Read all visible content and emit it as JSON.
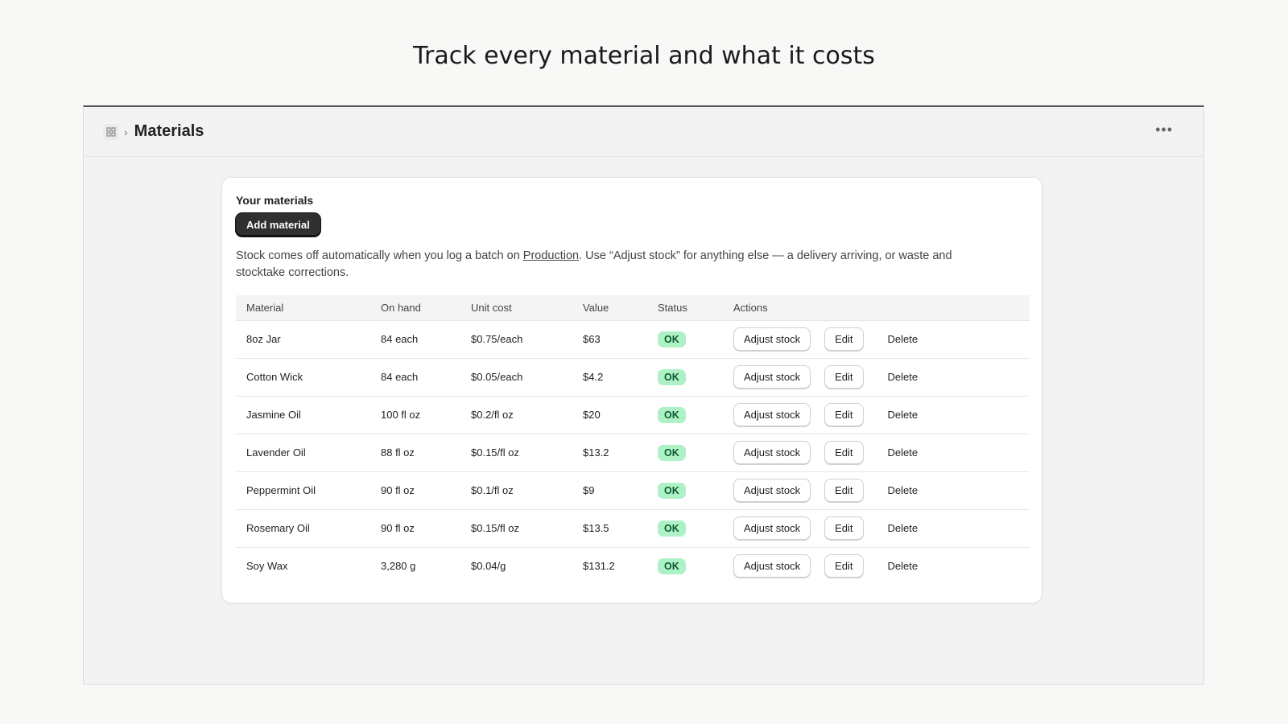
{
  "headline": "Track every material and what it costs",
  "breadcrumb": {
    "title": "Materials",
    "app_icon": "grid-icon",
    "more_icon": "ellipsis-icon"
  },
  "card": {
    "title": "Your materials",
    "add_label": "Add material",
    "desc_before": "Stock comes off automatically when you log a batch on ",
    "desc_link": "Production",
    "desc_after": ". Use “Adjust stock” for anything else — a delivery arriving, or waste and stocktake corrections."
  },
  "table": {
    "headers": [
      "Material",
      "On hand",
      "Unit cost",
      "Value",
      "Status",
      "Actions"
    ],
    "rows": [
      {
        "material": "8oz Jar",
        "on_hand": "84 each",
        "unit_cost": "$0.75/each",
        "value": "$63",
        "status": "OK"
      },
      {
        "material": "Cotton Wick",
        "on_hand": "84 each",
        "unit_cost": "$0.05/each",
        "value": "$4.2",
        "status": "OK"
      },
      {
        "material": "Jasmine Oil",
        "on_hand": "100 fl oz",
        "unit_cost": "$0.2/fl oz",
        "value": "$20",
        "status": "OK"
      },
      {
        "material": "Lavender Oil",
        "on_hand": "88 fl oz",
        "unit_cost": "$0.15/fl oz",
        "value": "$13.2",
        "status": "OK"
      },
      {
        "material": "Peppermint Oil",
        "on_hand": "90 fl oz",
        "unit_cost": "$0.1/fl oz",
        "value": "$9",
        "status": "OK"
      },
      {
        "material": "Rosemary Oil",
        "on_hand": "90 fl oz",
        "unit_cost": "$0.15/fl oz",
        "value": "$13.5",
        "status": "OK"
      },
      {
        "material": "Soy Wax",
        "on_hand": "3,280 g",
        "unit_cost": "$0.04/g",
        "value": "$131.2",
        "status": "OK"
      }
    ],
    "actions": {
      "adjust": "Adjust stock",
      "edit": "Edit",
      "delete": "Delete"
    }
  },
  "colors": {
    "accent_dark": "#303030",
    "ok_bg": "#aff1c6",
    "ok_text": "#0b5a2b"
  }
}
